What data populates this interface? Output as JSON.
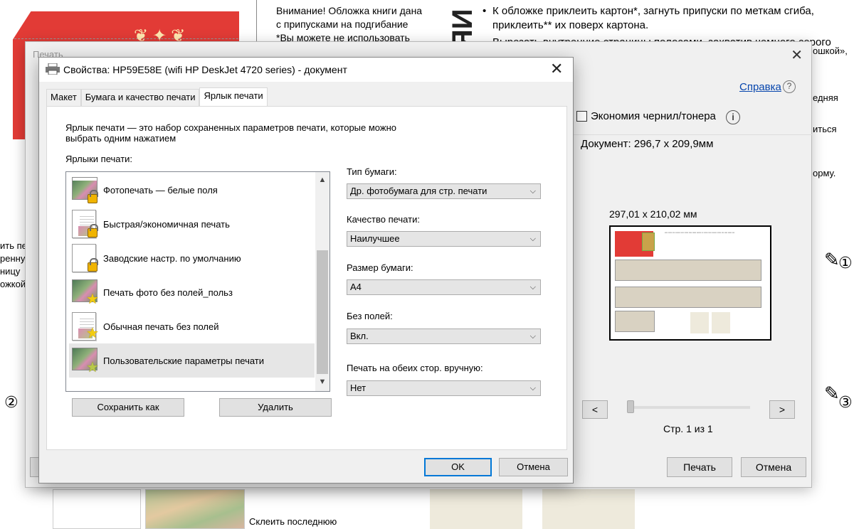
{
  "background": {
    "warning_lines": [
      "Внимание! Обложка книги дана",
      "с припусками на подгибание",
      "*Вы можете не использовать"
    ],
    "vertical_title": "ЯИ",
    "bullet": "•",
    "instructions": [
      "К обложке приклеить картон*, загнуть припуски по меткам сгиба, приклеить** их поверх картона.",
      "Вырезать внутренние страницы полосами, захватив чемного серого"
    ],
    "right_fragments": [
      "ошкой»,",
      "едняя",
      "иться",
      "орму."
    ],
    "left_fragments": [
      "ить пер",
      "ренную",
      "ницу",
      "ожкой"
    ],
    "circle_numbers": [
      "①",
      "②",
      "③"
    ],
    "bottom_label": "Склеить последнюю"
  },
  "print_dialog": {
    "title": "Печать",
    "help_link": "Справка",
    "help_icon": "?",
    "ink_saving_label": "Экономия чернил/тонера",
    "info_icon": "i",
    "document_size": "Документ: 296,7 x 209,9мм",
    "preview_size": "297,01 x 210,02 мм",
    "prev_page": "<",
    "next_page": ">",
    "page_indicator": "Стр. 1 из 1",
    "print_button": "Печать",
    "cancel_button": "Отмена"
  },
  "properties_dialog": {
    "title": "Свойства: HP59E58E (wifi HP DeskJet 4720 series) - документ",
    "close_icon": "✕",
    "tabs": [
      {
        "label": "Макет",
        "active": false
      },
      {
        "label": "Бумага и качество печати",
        "active": false
      },
      {
        "label": "Ярлык печати",
        "active": true
      }
    ],
    "intro_text": "Ярлык печати — это набор сохраненных параметров печати, которые можно выбрать одним нажатием",
    "shortcuts_label": "Ярлыки печати:",
    "shortcuts": [
      {
        "label": "Фотопечать — белые поля",
        "icon": "photo-lock-icon",
        "selected": false
      },
      {
        "label": "Быстрая/экономичная печать",
        "icon": "document-lock-icon",
        "selected": false
      },
      {
        "label": "Заводские настр. по умолчанию",
        "icon": "blank-lock-icon",
        "selected": false
      },
      {
        "label": "Печать фото без полей_польз",
        "icon": "photo-star-icon",
        "selected": false
      },
      {
        "label": "Обычная печать без полей",
        "icon": "document-star-icon",
        "selected": false
      },
      {
        "label": "Пользовательские параметры печати",
        "icon": "photo-star-icon",
        "selected": true
      }
    ],
    "save_as_button": "Сохранить как",
    "delete_button": "Удалить",
    "fields": [
      {
        "label": "Тип бумаги:",
        "value": "Др. фотобумага для стр. печати"
      },
      {
        "label": "Качество печати:",
        "value": "Наилучшее"
      },
      {
        "label": "Размер бумаги:",
        "value": "A4"
      },
      {
        "label": "Без полей:",
        "value": "Вкл."
      },
      {
        "label": "Печать на обеих стор. вручную:",
        "value": "Нет"
      }
    ],
    "ok_button": "OK",
    "cancel_button": "Отмена"
  }
}
